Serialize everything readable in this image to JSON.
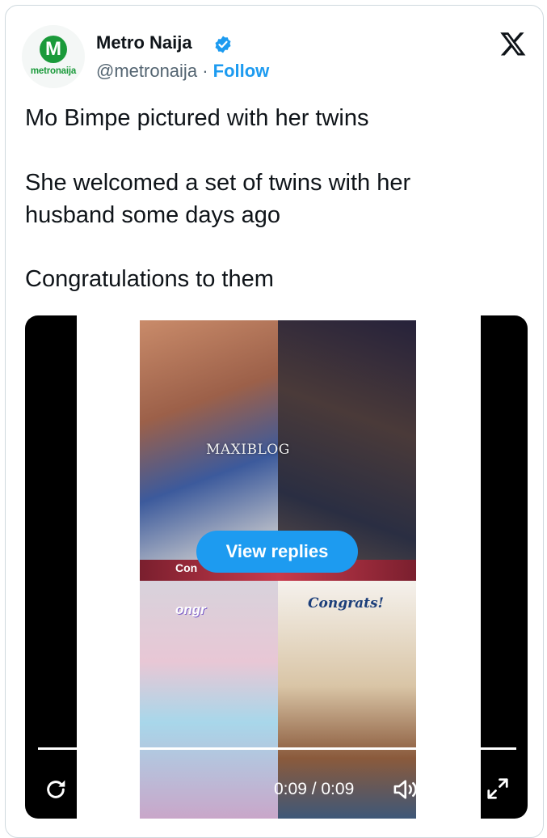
{
  "tweet": {
    "author_name": "Metro Naija",
    "handle": "@metronaija",
    "separator": "·",
    "follow_label": "Follow",
    "avatar": {
      "letter": "M",
      "wordmark": "metronaija",
      "color": "#1a9a3a"
    },
    "verified_icon": "verified-badge-icon",
    "platform_icon": "x-logo-icon",
    "text_lines": [
      "Mo Bimpe pictured with her twins",
      "She welcomed a set of twins with her",
      "husband some days ago",
      "Congratulations to them"
    ]
  },
  "video": {
    "watermark": "MAXIBLOG",
    "banner_text": "Con",
    "tag_left": "ongr",
    "tag_right": "Congrats!",
    "view_replies_label": "View replies",
    "time_display": "0:09 / 0:09",
    "progress": 1.0,
    "icons": {
      "replay": "replay-icon",
      "volume": "volume-icon",
      "x": "x-logo-icon",
      "fullscreen": "fullscreen-icon"
    }
  },
  "colors": {
    "accent": "#1d9bf0",
    "text": "#0f1419",
    "secondary": "#536471"
  }
}
